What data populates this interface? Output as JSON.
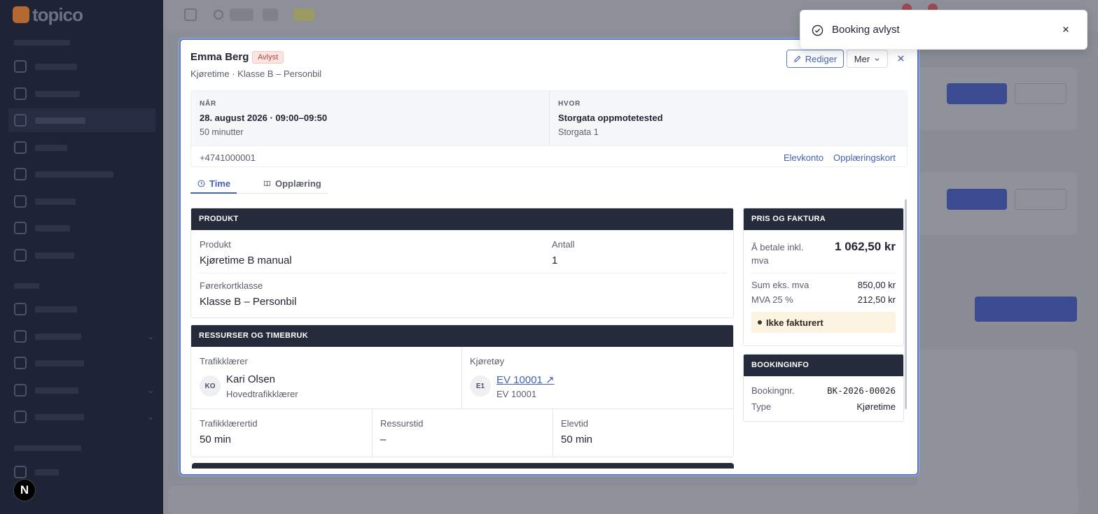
{
  "app": {
    "logo": "topico"
  },
  "modal": {
    "name": "Emma Berg",
    "status": "Avlyst",
    "subtitle": "Kjøretime · Klasse B – Personbil",
    "edit_label": "Rediger",
    "more_label": "Mer",
    "when": {
      "label": "NÅR",
      "value": "28. august 2026 · 09:00–09:50",
      "duration": "50 minutter"
    },
    "where": {
      "label": "HVOR",
      "value": "Storgata oppmotetested",
      "address": "Storgata 1"
    },
    "phone": "+4741000001",
    "links": {
      "student_account": "Elevkonto",
      "training_card": "Opplæringskort"
    },
    "tabs": [
      {
        "label": "Time"
      },
      {
        "label": "Opplæring"
      }
    ],
    "product": {
      "header": "PRODUKT",
      "product_label": "Produkt",
      "product_value": "Kjøretime B manual",
      "quantity_label": "Antall",
      "quantity_value": "1",
      "class_label": "Førerkortklasse",
      "class_value": "Klasse B – Personbil"
    },
    "resources": {
      "header": "RESSURSER OG TIMEBRUK",
      "instructor_label": "Trafikklærer",
      "instructor_initials": "KO",
      "instructor_name": "Kari Olsen",
      "instructor_role": "Hovedtrafikklærer",
      "vehicle_label": "Kjøretøy",
      "vehicle_initials": "E1",
      "vehicle_link": "EV 10001 ↗",
      "vehicle_sub": "EV 10001",
      "instructor_time_label": "Trafikklærertid",
      "instructor_time_value": "50 min",
      "resource_time_label": "Ressurstid",
      "resource_time_value": "–",
      "student_time_label": "Elevtid",
      "student_time_value": "50 min"
    },
    "pricing": {
      "header": "PRIS OG FAKTURA",
      "total_label": "Å betale inkl. mva",
      "total_value": "1 062,50 kr",
      "ex_vat_label": "Sum eks. mva",
      "ex_vat_value": "850,00 kr",
      "vat_label": "MVA 25 %",
      "vat_value": "212,50 kr",
      "invoice_status": "Ikke fakturert"
    },
    "booking_info": {
      "header": "BOOKINGINFO",
      "number_label": "Bookingnr.",
      "number_value": "BK-2026-00026",
      "type_label": "Type",
      "type_value": "Kjøretime"
    }
  },
  "toast": {
    "message": "Booking avlyst"
  },
  "colors": {
    "accent": "#4460b3",
    "section_header": "#252b3a",
    "cancelled_badge": "#fbe4e1",
    "invoice_badge": "#fdf3e1"
  }
}
